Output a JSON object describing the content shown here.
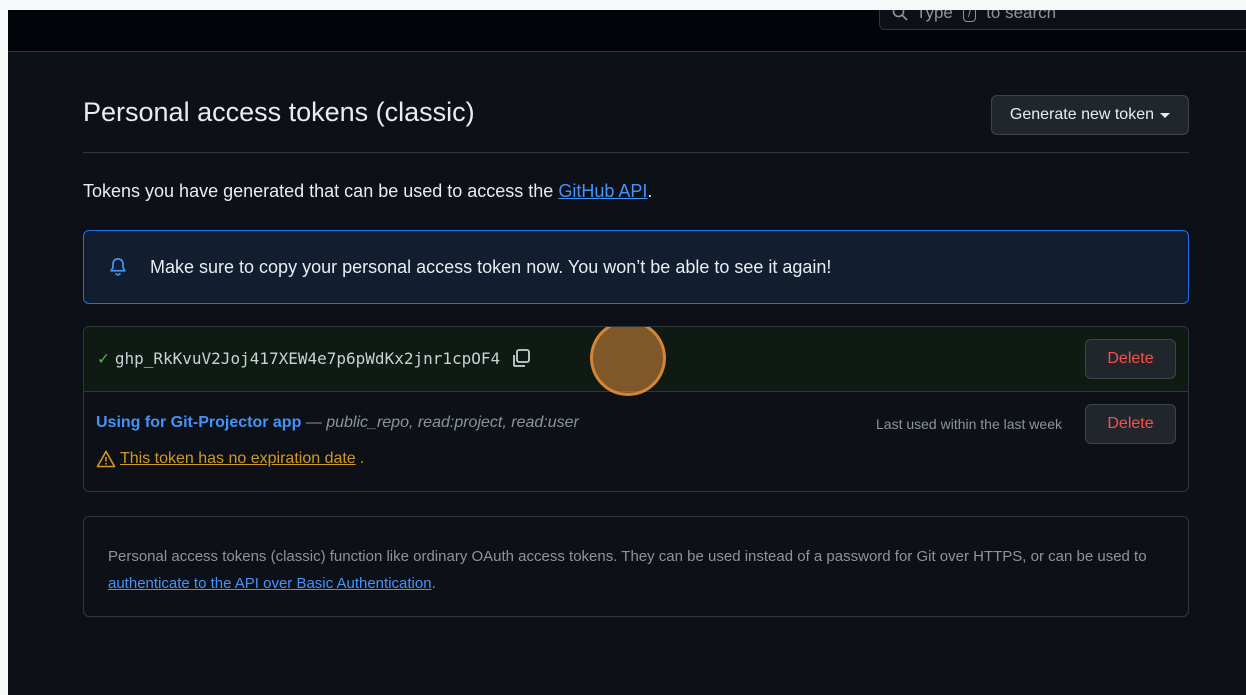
{
  "search": {
    "text_before": "Type",
    "slash_key": "/",
    "text_after": "to search"
  },
  "header": {
    "title": "Personal access tokens (classic)",
    "generate_button": "Generate new token"
  },
  "intro": {
    "text": "Tokens you have generated that can be used to access the ",
    "link": "GitHub API",
    "suffix": "."
  },
  "flash": {
    "message": "Make sure to copy your personal access token now. You won’t be able to see it again!",
    "icon": "bell-icon"
  },
  "new_token": {
    "value": "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",
    "delete_label": "Delete"
  },
  "existing_token": {
    "name": "Using for Git-Projector app",
    "separator": " — ",
    "scopes": "public_repo, read:project, read:user",
    "warning": "This token has no expiration date",
    "warning_suffix": ".",
    "last_used": "Last used within the last week",
    "delete_label": "Delete"
  },
  "info": {
    "text": "Personal access tokens (classic) function like ordinary OAuth access tokens. They can be used instead of a password for Git over HTTPS, or can be used to ",
    "link": "authenticate to the API over Basic Authentication",
    "suffix": "."
  },
  "colors": {
    "background": "#0d1117",
    "link": "#4493f8",
    "danger": "#f85149",
    "success": "#3fb950",
    "warning": "#d29922",
    "flash_border": "#1f6feb"
  }
}
